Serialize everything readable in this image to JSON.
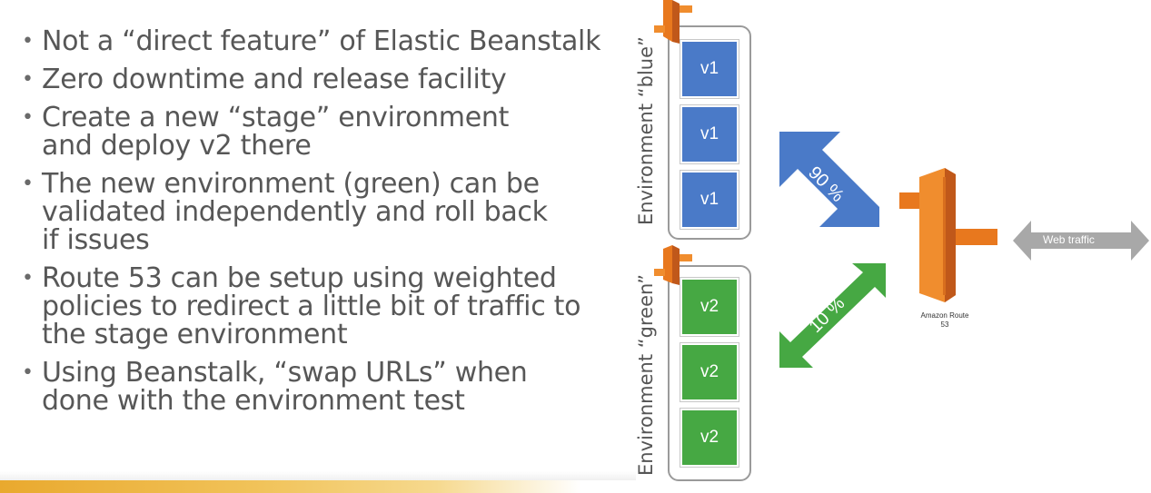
{
  "bullets": [
    "Not a “direct feature” of Elastic Beanstalk",
    "Zero downtime and release facility",
    "Create a new “stage” environment and deploy v2 there",
    "The new environment (green) can be validated independently and roll back if issues",
    "Route 53 can be setup using weighted policies to redirect a little bit of traffic to the stage environment",
    "Using Beanstalk, “swap URLs” when done with the environment test"
  ],
  "diagram": {
    "env_blue": {
      "label": "Environment “blue”",
      "instances": [
        "v1",
        "v1",
        "v1"
      ],
      "color": "#4a7ac8"
    },
    "env_green": {
      "label": "Environment “green”",
      "instances": [
        "v2",
        "v2",
        "v2"
      ],
      "color": "#46a843"
    },
    "blue_weight": "90 %",
    "green_weight": "10 %",
    "route53_label": "Amazon Route 53",
    "web_traffic_label": "Web traffic",
    "accent_orange": "#e8781e"
  }
}
